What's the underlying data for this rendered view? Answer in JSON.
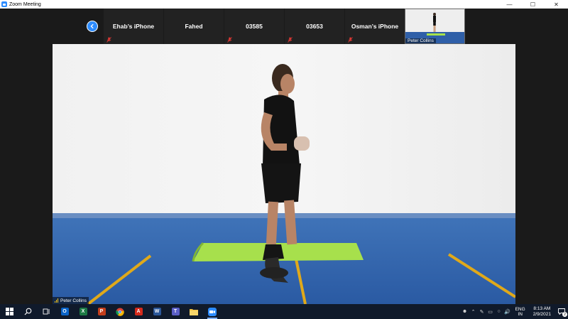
{
  "window": {
    "title": "Zoom Meeting",
    "minimize": "—",
    "maximize": "☐",
    "close": "✕"
  },
  "participants": [
    {
      "name": "Ehab’s iPhone",
      "muted": true
    },
    {
      "name": "Fahed",
      "muted": false
    },
    {
      "name": "03585",
      "muted": true
    },
    {
      "name": "03653",
      "muted": true
    },
    {
      "name": "Osman’s iPhone",
      "muted": true
    }
  ],
  "self_view": {
    "name": "Peter Collins"
  },
  "main_video": {
    "speaker_name": "Peter Collins"
  },
  "taskbar": {
    "apps": [
      {
        "icon": "windows-start-icon"
      },
      {
        "icon": "search-icon"
      },
      {
        "icon": "task-view-icon"
      },
      {
        "icon": "outlook-icon",
        "letter": "O",
        "color": "#0a64c8"
      },
      {
        "icon": "excel-icon",
        "letter": "X",
        "color": "#1d7a45"
      },
      {
        "icon": "powerpoint-icon",
        "letter": "P",
        "color": "#c43e1c"
      },
      {
        "icon": "chrome-icon",
        "letter": "",
        "color": "#e8b020"
      },
      {
        "icon": "acrobat-icon",
        "letter": "A",
        "color": "#d42a1c"
      },
      {
        "icon": "word-icon",
        "letter": "W",
        "color": "#2b579a"
      },
      {
        "icon": "teams-icon",
        "letter": "T",
        "color": "#5b5fc7"
      },
      {
        "icon": "file-explorer-icon",
        "letter": "",
        "color": "#f0c040"
      },
      {
        "icon": "zoom-icon",
        "letter": "",
        "color": "#2d8cff"
      }
    ],
    "language": {
      "line1": "ENG",
      "line2": "IN"
    },
    "time": "8:13 AM",
    "date": "2/9/2021",
    "notification_count": "2"
  }
}
